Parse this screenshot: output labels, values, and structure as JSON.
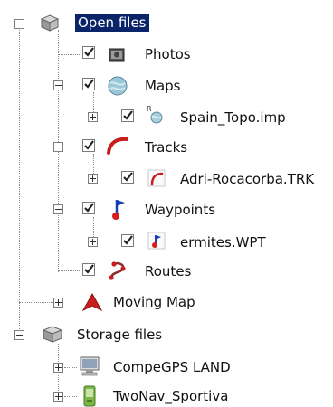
{
  "tree": {
    "open_files": "Open files",
    "photos": "Photos",
    "maps": "Maps",
    "map_file": "Spain_Topo.imp",
    "tracks": "Tracks",
    "track_file": "Adri-Rocacorba.TRK",
    "waypoints": "Waypoints",
    "waypoint_file": "ermites.WPT",
    "routes": "Routes",
    "moving_map": "Moving Map",
    "storage_files": "Storage files",
    "device_pc": "CompeGPS LAND",
    "device_gps": "TwoNav_Sportiva"
  },
  "icons": {
    "open_files": "database-icon",
    "photos": "camera-icon",
    "maps": "map-globe-icon",
    "map_file": "map-file-icon",
    "tracks": "track-icon",
    "track_file": "track-file-icon",
    "waypoints": "waypoint-flag-icon",
    "waypoint_file": "waypoint-file-icon",
    "routes": "route-icon",
    "moving_map": "moving-map-arrow-icon",
    "storage_files": "database-icon",
    "device_pc": "computer-icon",
    "device_gps": "gps-device-icon"
  },
  "colors": {
    "selection": "#0a246a",
    "track": "#c81e1e",
    "waypoint": "#1a3db8",
    "gps_device": "#7ab648"
  }
}
